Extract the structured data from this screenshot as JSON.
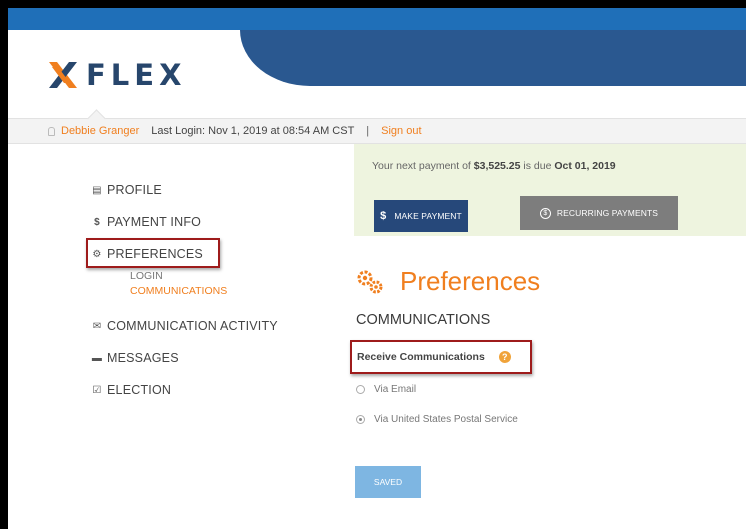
{
  "brand": {
    "name": "FLEX",
    "colors": {
      "accent": "#f07f1f",
      "navy": "#27466c",
      "header_band": "#2a5890",
      "top_bar": "#1f6fb8",
      "highlight_box": "#9e1b1b"
    }
  },
  "userbar": {
    "user_name": "Debbie Granger",
    "last_login": "Last Login: Nov 1, 2019 at 08:54 AM CST",
    "separator": "|",
    "sign_out": "Sign out"
  },
  "sidebar": {
    "items": [
      {
        "icon": "id-card-icon",
        "label": "PROFILE"
      },
      {
        "icon": "dollar-icon",
        "label": "PAYMENT INFO"
      },
      {
        "icon": "gears-icon",
        "label": "PREFERENCES"
      },
      {
        "icon": "envelope-icon",
        "label": "COMMUNICATION ACTIVITY"
      },
      {
        "icon": "chat-bubble-icon",
        "label": "MESSAGES"
      },
      {
        "icon": "checkbox-icon",
        "label": "ELECTION"
      }
    ],
    "sub_items": [
      "LOGIN",
      "COMMUNICATIONS"
    ],
    "active_sub": "COMMUNICATIONS"
  },
  "banner": {
    "prefix": "Your next payment of ",
    "amount": "$3,525.25",
    "middle": " is due ",
    "due_date": "Oct 01, 2019",
    "make_payment": "MAKE PAYMENT",
    "recurring_payments": "RECURRING PAYMENTS"
  },
  "main": {
    "title": "Preferences",
    "section_heading": "COMMUNICATIONS",
    "receive_label": "Receive Communications",
    "help_glyph": "?",
    "options": [
      {
        "label": "Via Email",
        "selected": false
      },
      {
        "label": "Via United States Postal Service",
        "selected": true
      }
    ],
    "saved_button": "SAVED"
  }
}
